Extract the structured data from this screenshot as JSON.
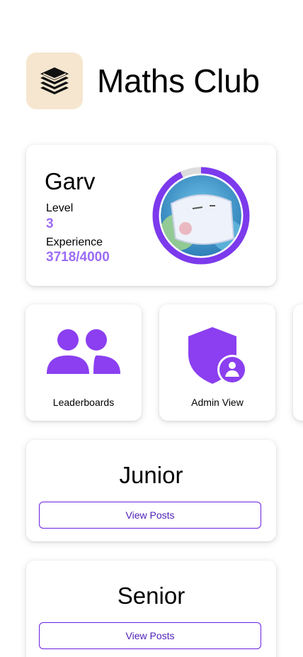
{
  "app": {
    "title": "Maths Club",
    "logo_icon": "stacked-books-icon"
  },
  "profile": {
    "name": "Garv",
    "level_label": "Level",
    "level_value": "3",
    "experience_label": "Experience",
    "experience_value": "3718/4000",
    "experience_fraction": 0.9295,
    "avatar_icon": "cartoon-avatar-image"
  },
  "tiles": [
    {
      "label": "Leaderboards",
      "icon": "people-group-icon"
    },
    {
      "label": "Admin View",
      "icon": "admin-shield-icon"
    }
  ],
  "groups": [
    {
      "title": "Junior",
      "button_label": "View Posts"
    },
    {
      "title": "Senior",
      "button_label": "View Posts"
    }
  ],
  "colors": {
    "accent": "#7c3aed",
    "ring_track": "#dcdcdc",
    "value_text": "#9b6cf5",
    "logo_bg": "#f6e6cf",
    "button_border": "#6a1fe0"
  }
}
